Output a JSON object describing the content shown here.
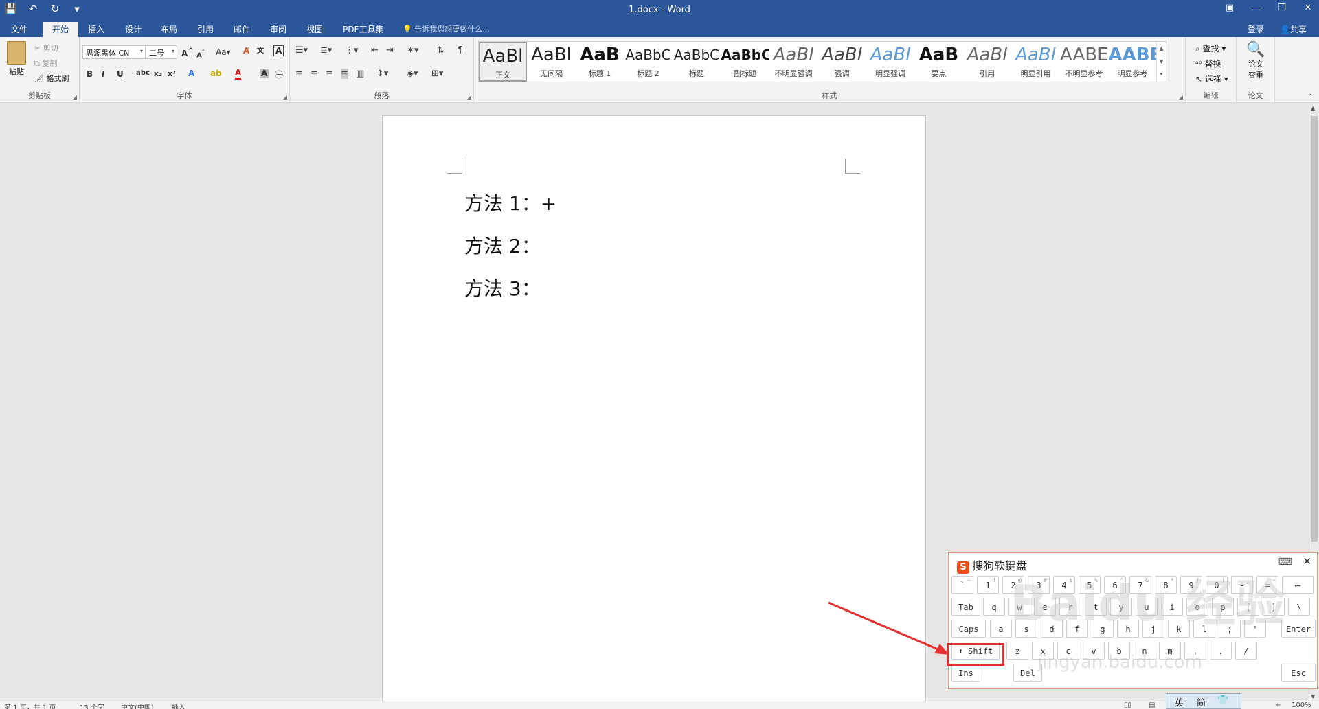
{
  "titlebar": {
    "doc_title": "1.docx - Word",
    "qat": [
      "save-icon",
      "undo-icon",
      "redo-icon",
      "customize-icon"
    ],
    "qat_glyphs": [
      "💾",
      "↶",
      "↻",
      "▾"
    ],
    "win_glyphs": [
      "▣",
      "—",
      "❐",
      "✕"
    ]
  },
  "tabs": {
    "items": [
      "文件",
      "开始",
      "插入",
      "设计",
      "布局",
      "引用",
      "邮件",
      "审阅",
      "视图",
      "PDF工具集"
    ],
    "active": "开始",
    "tell_me": "告诉我您想要做什么...",
    "login": "登录",
    "share": "共享"
  },
  "ribbon": {
    "clipboard": {
      "label": "剪贴板",
      "paste": "粘贴",
      "cut": "剪切",
      "copy": "复制",
      "format_painter": "格式刷"
    },
    "font": {
      "label": "字体",
      "font_name": "思源黑体 CN",
      "font_size": "二号",
      "change_case": "Aa"
    },
    "paragraph": {
      "label": "段落"
    },
    "styles": {
      "label": "样式",
      "items": [
        {
          "preview": "AaBl",
          "name": "正文",
          "selected": true
        },
        {
          "preview": "AaBl",
          "name": "无间隔"
        },
        {
          "preview": "AaB",
          "name": "标题 1"
        },
        {
          "preview": "AaBbC",
          "name": "标题 2"
        },
        {
          "preview": "AaBbC",
          "name": "标题"
        },
        {
          "preview": "AaBbC",
          "name": "副标题"
        },
        {
          "preview": "AaBl",
          "name": "不明显强调"
        },
        {
          "preview": "AaBl",
          "name": "强调"
        },
        {
          "preview": "AaBl",
          "name": "明显强调"
        },
        {
          "preview": "AaB",
          "name": "要点"
        },
        {
          "preview": "AaBl",
          "name": "引用"
        },
        {
          "preview": "AaBl",
          "name": "明显引用"
        },
        {
          "preview": "AABE",
          "name": "不明显参考"
        },
        {
          "preview": "AABE",
          "name": "明显参考"
        }
      ]
    },
    "editing": {
      "label": "编辑",
      "find": "查找",
      "replace": "替换",
      "select": "选择"
    },
    "paper": {
      "label": "论文",
      "check": "论文",
      "check2": "查重"
    }
  },
  "document": {
    "lines": [
      "方法 1：+",
      "方法 2：",
      "方法 3："
    ]
  },
  "keyboard": {
    "title": "搜狗软键盘",
    "row1": [
      "`",
      "1",
      "2",
      "3",
      "4",
      "5",
      "6",
      "7",
      "8",
      "9",
      "0",
      "-",
      "=",
      "⟵"
    ],
    "row1_shift": [
      "~",
      "!",
      "@",
      "#",
      "$",
      "%",
      "^",
      "&",
      "*",
      "(",
      ")",
      "_",
      "+",
      ""
    ],
    "row2": [
      "Tab",
      "q",
      "w",
      "e",
      "r",
      "t",
      "y",
      "u",
      "i",
      "o",
      "p",
      "[",
      "]",
      "\\"
    ],
    "row3": [
      "Caps",
      "a",
      "s",
      "d",
      "f",
      "g",
      "h",
      "j",
      "k",
      "l",
      ";",
      "'",
      "Enter"
    ],
    "row4": [
      "⬆ Shift",
      "z",
      "x",
      "c",
      "v",
      "b",
      "n",
      "m",
      ",",
      ".",
      "/"
    ],
    "row5": [
      "Ins",
      "Del",
      "Esc"
    ]
  },
  "watermark": {
    "main": "Baidu 经验",
    "sub": "jingyan.baidu.com"
  },
  "statusbar": {
    "page": "第 1 页，共 1 页",
    "words": "13 个字",
    "lang": "中文(中国)",
    "mode": "插入",
    "zoom": "100%"
  },
  "ime": {
    "lang": "英",
    "mode": "简"
  },
  "colors": {
    "title_blue": "#2b579a",
    "highlight_red": "#e53030"
  }
}
